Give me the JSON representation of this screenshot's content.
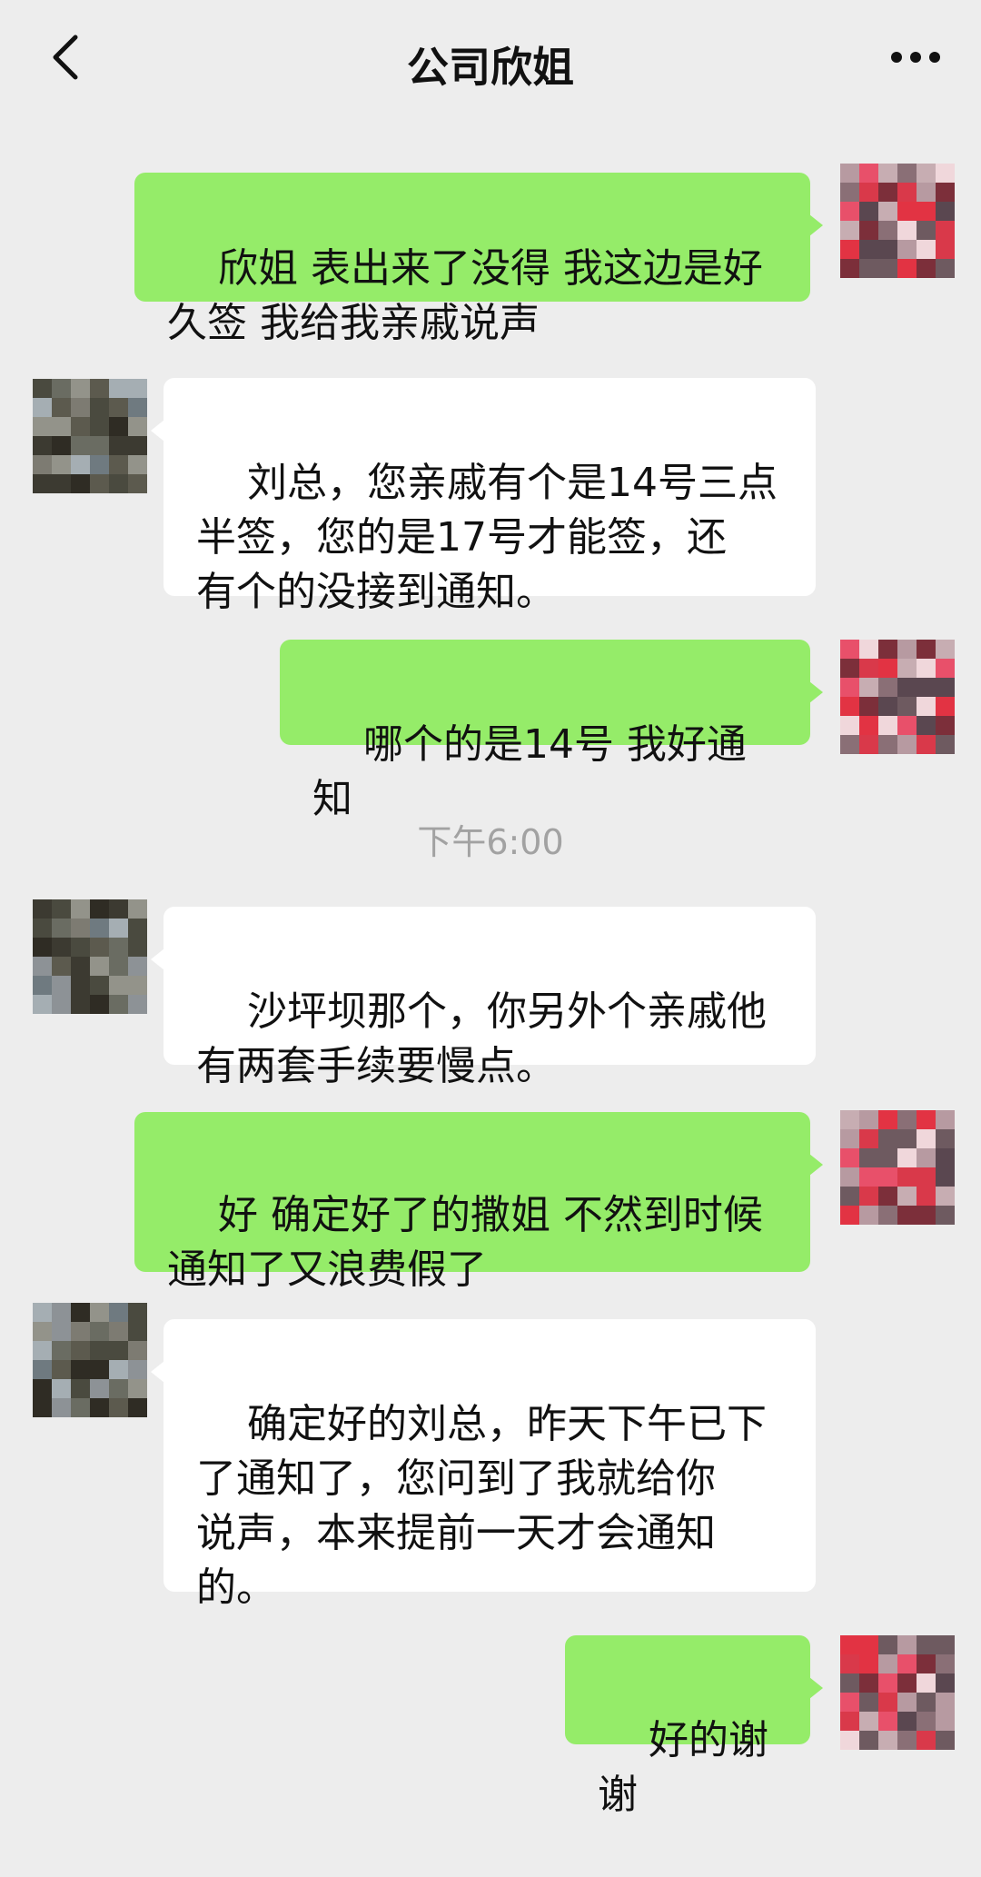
{
  "header": {
    "title": "公司欣姐",
    "back_icon": "chevron-left-icon",
    "more_icon": "more-dots-icon"
  },
  "colors": {
    "background": "#ededed",
    "my_bubble": "#95ec69",
    "their_bubble": "#ffffff",
    "timestamp_text": "#a2a2a2"
  },
  "messages": [
    {
      "sender": "me",
      "text": "欣姐 表出来了没得 我这边是好\n久签 我给我亲戚说声"
    },
    {
      "sender": "them",
      "text": "刘总，您亲戚有个是14号三点\n半签，您的是17号才能签，还\n有个的没接到通知。"
    },
    {
      "sender": "me",
      "text": "哪个的是14号 我好通知"
    },
    {
      "sender": "them",
      "text": "沙坪坝那个，你另外个亲戚他\n有两套手续要慢点。"
    },
    {
      "sender": "me",
      "text": "好 确定好了的撒姐 不然到时候\n通知了又浪费假了"
    },
    {
      "sender": "them",
      "text": "确定好的刘总，昨天下午已下\n了通知了，您问到了我就给你\n说声，本来提前一天才会通知\n的。"
    },
    {
      "sender": "me",
      "text": "好的谢谢"
    }
  ],
  "timestamp": "下午6:00"
}
